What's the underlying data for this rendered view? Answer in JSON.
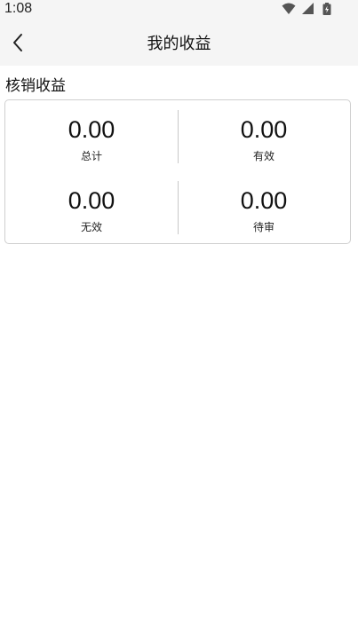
{
  "status_bar": {
    "time": "1:08",
    "icons": [
      "wifi-icon",
      "signal-icon",
      "battery-icon"
    ]
  },
  "app_bar": {
    "title": "我的收益",
    "back_icon": "chevron-left-icon"
  },
  "section": {
    "title": "核销收益"
  },
  "stats": [
    {
      "value": "0.00",
      "label": "总计"
    },
    {
      "value": "0.00",
      "label": "有效"
    },
    {
      "value": "0.00",
      "label": "无效"
    },
    {
      "value": "0.00",
      "label": "待审"
    }
  ]
}
